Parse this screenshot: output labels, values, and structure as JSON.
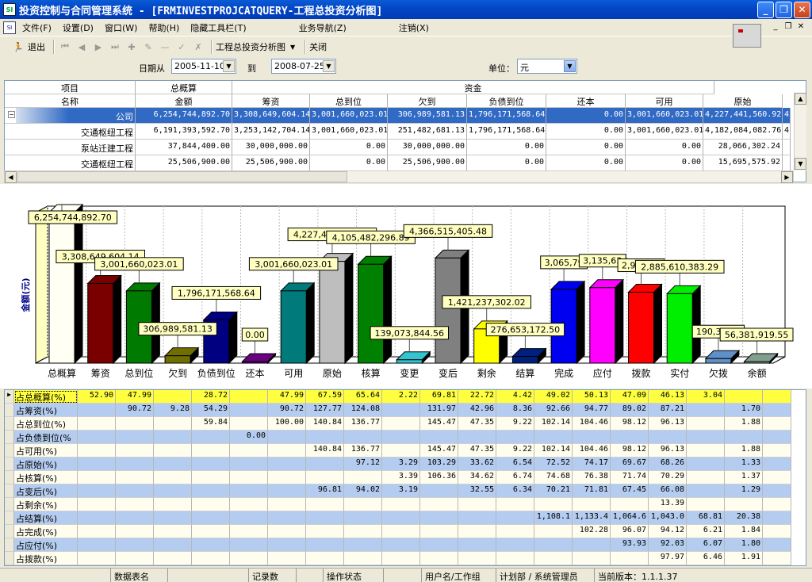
{
  "window": {
    "title": "投资控制与合同管理系统 - [FRMINVESTPROJCATQUERY-工程总投资分析图]",
    "minimize": "_",
    "restore": "❐",
    "close": "✕"
  },
  "menu": [
    {
      "label": "文件(F)"
    },
    {
      "label": "设置(D)"
    },
    {
      "label": "窗口(W)"
    },
    {
      "label": "帮助(H)"
    },
    {
      "label": "隐藏工具栏(T)"
    },
    {
      "label": "业务导航(Z)"
    },
    {
      "label": "注销(X)"
    }
  ],
  "toolbar": {
    "exit_label": "退出",
    "report_label": "工程总投资分析图",
    "close_label": "关闭"
  },
  "filter": {
    "date_from_label": "日期从",
    "date_from": "2005-11-10",
    "to_label": "到",
    "date_to": "2008-07-25",
    "unit_label": "单位：",
    "unit": "元"
  },
  "top_grid": {
    "header_row1": [
      "项目",
      "总概算",
      "资金"
    ],
    "header_row2": [
      "名称",
      "金额",
      "筹资",
      "总到位",
      "欠到",
      "负债到位",
      "还本",
      "可用",
      "原始"
    ],
    "rows": [
      {
        "name": "公司",
        "values": [
          "6,254,744,892.70",
          "3,308,649,604.14",
          "3,001,660,023.01",
          "306,989,581.13",
          "1,796,171,568.64",
          "0.00",
          "3,001,660,023.01",
          "4,227,441,560.92"
        ],
        "extra": "4"
      },
      {
        "name": "交通枢纽工程",
        "values": [
          "6,191,393,592.70",
          "3,253,142,704.14",
          "3,001,660,023.01",
          "251,482,681.13",
          "1,796,171,568.64",
          "0.00",
          "3,001,660,023.01",
          "4,182,084,082.76"
        ],
        "extra": "4"
      },
      {
        "name": "泵站迁建工程",
        "values": [
          "37,844,400.00",
          "30,000,000.00",
          "0.00",
          "30,000,000.00",
          "0.00",
          "0.00",
          "0.00",
          "28,066,302.24"
        ],
        "extra": ""
      },
      {
        "name": "交通枢纽工程",
        "values": [
          "25,506,900.00",
          "25,506,900.00",
          "0.00",
          "25,506,900.00",
          "0.00",
          "0.00",
          "0.00",
          "15,695,575.92"
        ],
        "extra": ""
      }
    ]
  },
  "chart_data": {
    "type": "bar",
    "ylabel": "金额(元)",
    "categories": [
      "总概算",
      "筹资",
      "总到位",
      "欠到",
      "负债到位",
      "还本",
      "可用",
      "原始",
      "核算",
      "变更",
      "变后",
      "剩余",
      "结算",
      "完成",
      "应付",
      "拨款",
      "实付",
      "欠拨",
      "余额"
    ],
    "values": [
      6254744892.7,
      3308649604.14,
      3001660023.01,
      306989581.13,
      1796171568.64,
      0.0,
      3001660023.01,
      4227441560.92,
      4105482296.89,
      139073844.56,
      4366515405.48,
      1421237302.02,
      276653172.5,
      3065790000,
      3135630000,
      2945270000,
      2885610383.29,
      190355000,
      56381919.55
    ],
    "data_labels": [
      "6,254,744,892.70",
      "3,308,649,604.14",
      "3,001,660,023.01",
      "306,989,581.13",
      "1,796,171,568.64",
      "0.00",
      "3,001,660,023.01",
      "4,227,441,560.92",
      "4,105,482,296.89",
      "139,073,844.56",
      "4,366,515,405.48",
      "1,421,237,302.02",
      "276,653,172.50",
      "3,065,79",
      "3,135,63",
      "2,945,27",
      "2,885,610,383.29",
      "190,355,7",
      "56,381,919.55"
    ],
    "colors": [
      "#FFFFF4",
      "#7A0000",
      "#007A00",
      "#6F6F00",
      "#000080",
      "#6A0080",
      "#007A7A",
      "#BEBEBE",
      "#008000",
      "#33C4D0",
      "#808080",
      "#FFFF00",
      "#002080",
      "#0000F0",
      "#FF00FF",
      "#FF0000",
      "#00EE00",
      "#6090C8",
      "#7FA08F"
    ]
  },
  "bottom_grid": {
    "rows": [
      {
        "name": "占总概算(%)",
        "cells": [
          "52.90",
          "47.99",
          "",
          "28.72",
          "",
          "47.99",
          "67.59",
          "65.64",
          "2.22",
          "69.81",
          "22.72",
          "4.42",
          "49.02",
          "50.13",
          "47.09",
          "46.13",
          "3.04",
          "",
          ""
        ],
        "selected": true
      },
      {
        "name": "占筹资(%)",
        "cells": [
          "",
          "90.72",
          "9.28",
          "54.29",
          "",
          "90.72",
          "127.77",
          "124.08",
          "",
          "131.97",
          "42.96",
          "8.36",
          "92.66",
          "94.77",
          "89.02",
          "87.21",
          "",
          "1.70",
          ""
        ]
      },
      {
        "name": "占总到位(%)",
        "cells": [
          "",
          "",
          "",
          "59.84",
          "",
          "100.00",
          "140.84",
          "136.77",
          "",
          "145.47",
          "47.35",
          "9.22",
          "102.14",
          "104.46",
          "98.12",
          "96.13",
          "",
          "1.88",
          ""
        ]
      },
      {
        "name": "占负债到位(%",
        "cells": [
          "",
          "",
          "",
          "",
          "0.00",
          "",
          "",
          "",
          "",
          "",
          "",
          "",
          "",
          "",
          "",
          "",
          "",
          "",
          ""
        ]
      },
      {
        "name": "占可用(%)",
        "cells": [
          "",
          "",
          "",
          "",
          "",
          "",
          "140.84",
          "136.77",
          "",
          "145.47",
          "47.35",
          "9.22",
          "102.14",
          "104.46",
          "98.12",
          "96.13",
          "",
          "1.88",
          ""
        ]
      },
      {
        "name": "占原始(%)",
        "cells": [
          "",
          "",
          "",
          "",
          "",
          "",
          "",
          "97.12",
          "3.29",
          "103.29",
          "33.62",
          "6.54",
          "72.52",
          "74.17",
          "69.67",
          "68.26",
          "",
          "1.33",
          ""
        ]
      },
      {
        "name": "占核算(%)",
        "cells": [
          "",
          "",
          "",
          "",
          "",
          "",
          "",
          "",
          "3.39",
          "106.36",
          "34.62",
          "6.74",
          "74.68",
          "76.38",
          "71.74",
          "70.29",
          "",
          "1.37",
          ""
        ]
      },
      {
        "name": "占变后(%)",
        "cells": [
          "",
          "",
          "",
          "",
          "",
          "",
          "96.81",
          "94.02",
          "3.19",
          "",
          "32.55",
          "6.34",
          "70.21",
          "71.81",
          "67.45",
          "66.08",
          "",
          "1.29",
          ""
        ]
      },
      {
        "name": "占剩余(%)",
        "cells": [
          "",
          "",
          "",
          "",
          "",
          "",
          "",
          "",
          "",
          "",
          "",
          "",
          "",
          "",
          "",
          "13.39",
          "",
          "",
          ""
        ]
      },
      {
        "name": "占结算(%)",
        "cells": [
          "",
          "",
          "",
          "",
          "",
          "",
          "",
          "",
          "",
          "",
          "",
          "",
          "1,108.1",
          "1,133.4",
          "1,064.6",
          "1,043.0",
          "68.81",
          "20.38",
          ""
        ]
      },
      {
        "name": "占完成(%)",
        "cells": [
          "",
          "",
          "",
          "",
          "",
          "",
          "",
          "",
          "",
          "",
          "",
          "",
          "",
          "102.28",
          "96.07",
          "94.12",
          "6.21",
          "1.84",
          ""
        ]
      },
      {
        "name": "占应付(%)",
        "cells": [
          "",
          "",
          "",
          "",
          "",
          "",
          "",
          "",
          "",
          "",
          "",
          "",
          "",
          "",
          "93.93",
          "92.03",
          "6.07",
          "1.80",
          ""
        ]
      },
      {
        "name": "占拨款(%)",
        "cells": [
          "",
          "",
          "",
          "",
          "",
          "",
          "",
          "",
          "",
          "",
          "",
          "",
          "",
          "",
          "",
          "97.97",
          "6.46",
          "1.91",
          ""
        ]
      }
    ]
  },
  "status": {
    "c1": "",
    "c2": "数据表名",
    "c3": "",
    "c4": "记录数",
    "c5": "",
    "c6": "操作状态",
    "c7": "",
    "c8": "用户名/工作组",
    "c9": "计划部 / 系统管理员",
    "c10": "当前版本：1.1.1.37"
  }
}
